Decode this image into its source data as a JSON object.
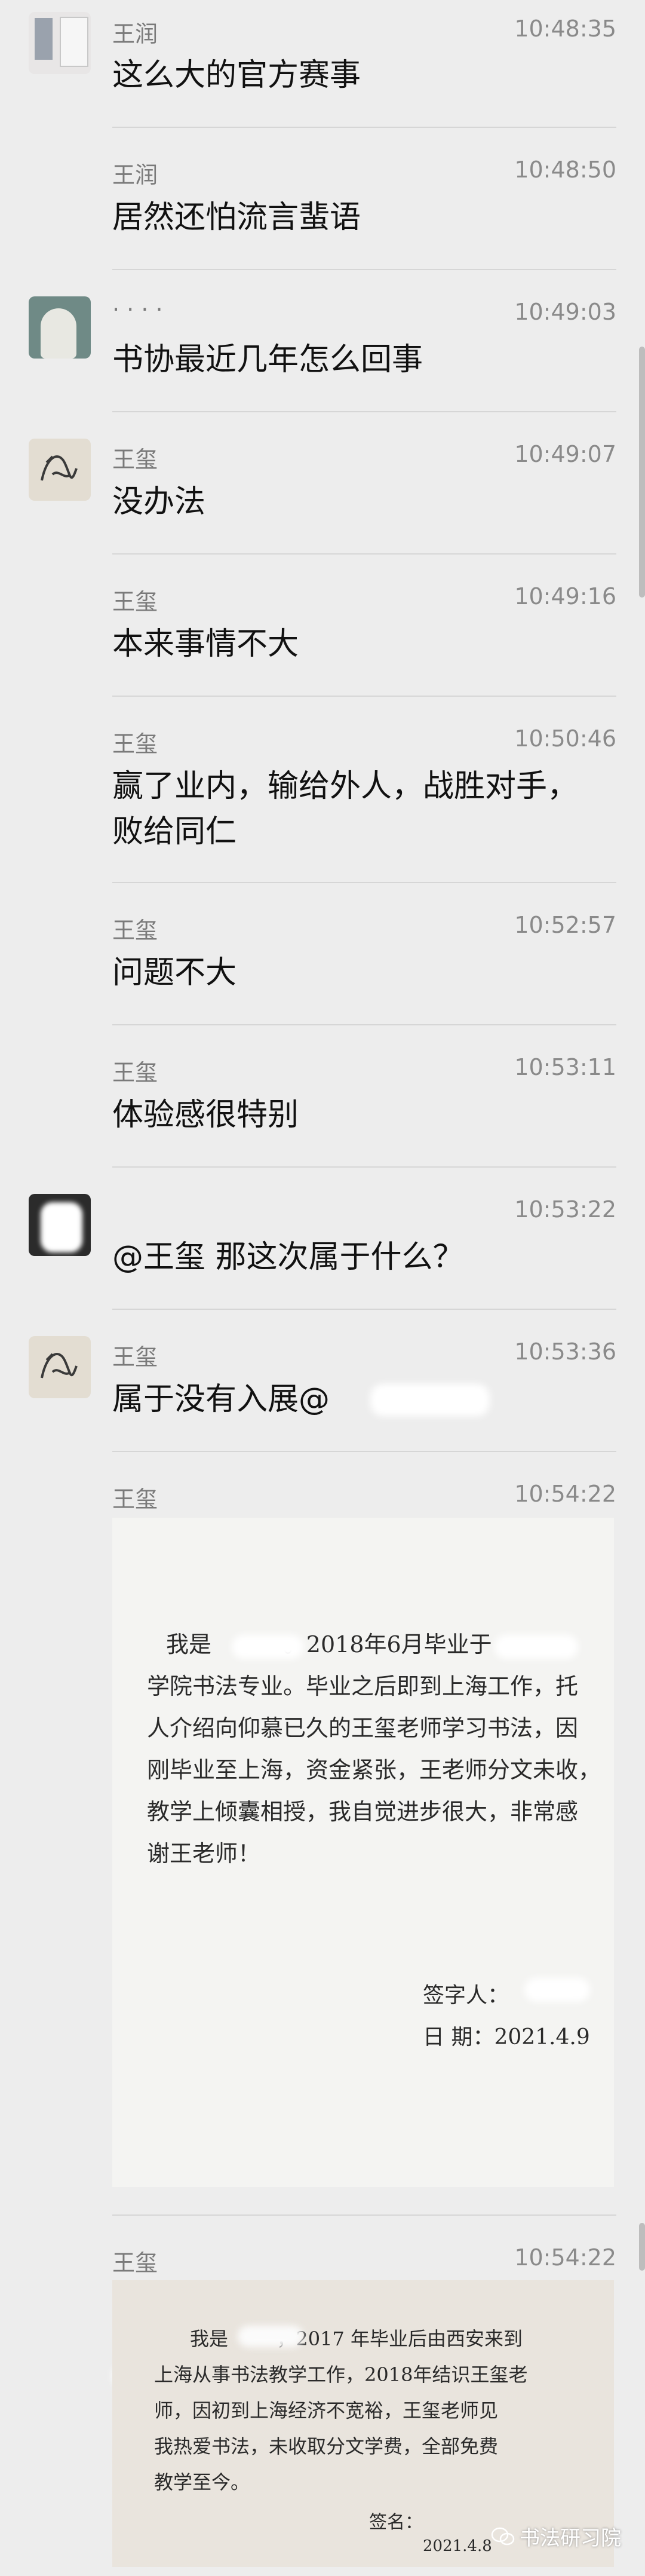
{
  "messages": [
    {
      "sender": "王润",
      "time": "10:48:35",
      "text": "这么大的官方赛事"
    },
    {
      "sender": "王润",
      "time": "10:48:50",
      "text": "居然还怕流言蜚语"
    },
    {
      "sender": "· · · ·",
      "time": "10:49:03",
      "text": "书协最近几年怎么回事"
    },
    {
      "sender": "王玺",
      "time": "10:49:07",
      "text": "没办法"
    },
    {
      "sender": "王玺",
      "time": "10:49:16",
      "text": "本来事情不大"
    },
    {
      "sender": "王玺",
      "time": "10:50:46",
      "text": "赢了业内，输给外人，战胜对手，败给同仁"
    },
    {
      "sender": "王玺",
      "time": "10:52:57",
      "text": "问题不大"
    },
    {
      "sender": "王玺",
      "time": "10:53:11",
      "text": "体验感很特别"
    },
    {
      "sender": "",
      "time": "10:53:22",
      "text": "@王玺 那这次属于什么？"
    },
    {
      "sender": "王玺",
      "time": "10:53:36",
      "text": "属于没有入展@"
    },
    {
      "sender": "王玺",
      "time": "10:54:22",
      "text": ""
    },
    {
      "sender": "王玺",
      "time": "10:54:22",
      "text": ""
    }
  ],
  "letter1": {
    "lines": [
      "我是          。2018年6月毕业于         ",
      "学院书法专业。毕业之后即到上海工作，托",
      "人介绍向仰慕已久的王玺老师学习书法，因",
      "刚毕业至上海，资金紧张，王老师分文未收，",
      "教学上倾囊相授，我自觉进步很大，非常感",
      "谢王老师！"
    ],
    "signature": "签字人：",
    "date": "日 期：2021.4.9"
  },
  "letter2": {
    "lines": [
      "我是        ，2017 年毕业后由西安来到",
      "上海从事书法教学工作，2018年结识王玺老",
      "师，因初到上海经济不宽裕，王玺老师见",
      "我热爱书法，未收取分文学费，全部免费",
      "教学至今。"
    ],
    "signature": "签名：",
    "date": "2021.4.8"
  },
  "watermark": "书法研习院"
}
